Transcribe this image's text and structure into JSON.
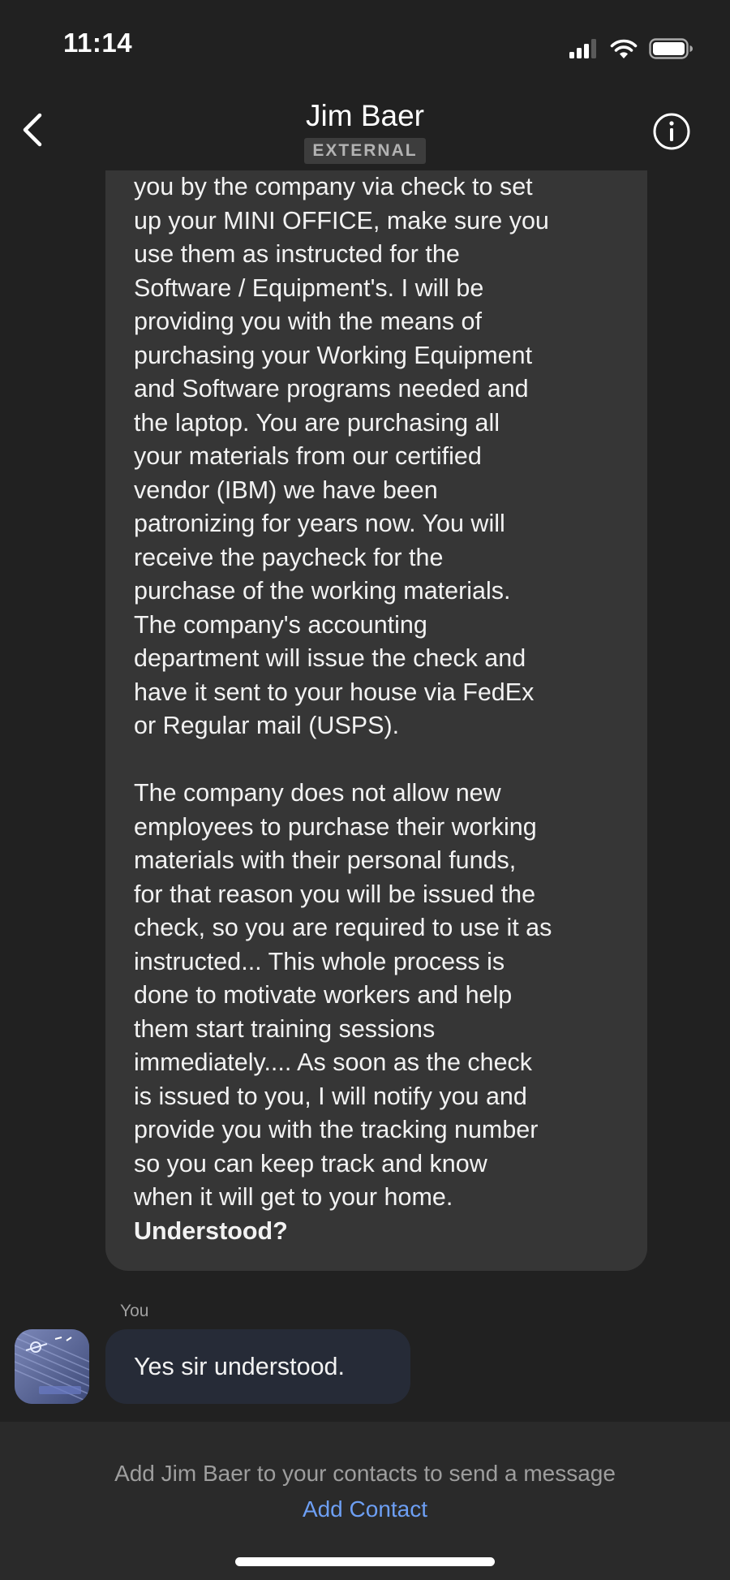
{
  "status_bar": {
    "time": "11:14",
    "signal_icon": "cellular-signal-icon",
    "wifi_icon": "wifi-icon",
    "battery_icon": "battery-icon"
  },
  "header": {
    "back_icon": "chevron-left-icon",
    "title": "Jim Baer",
    "badge": "EXTERNAL",
    "info_icon": "info-circle-icon"
  },
  "messages": {
    "incoming_para1": [
      "you by the company via check to set",
      "up your MINI OFFICE, make sure you",
      "use them as instructed for the",
      "Software / Equipment's. I will be",
      "providing you with the means of",
      "purchasing your Working Equipment",
      "and  Software programs needed and",
      "the laptop. You are purchasing all",
      "your materials from our certified",
      "vendor (IBM) we have been",
      "patronizing for years now. You will",
      "receive the paycheck for the",
      "purchase of the working materials.",
      "The company's accounting",
      "department will issue the check and",
      "have it sent to your house via FedEx",
      "or Regular mail (USPS)."
    ],
    "incoming_para2": [
      "The company does not allow new",
      "employees to purchase their working",
      "materials with their personal funds,",
      "for that reason you will be issued the",
      "check, so you are required to use it as",
      "instructed...  This whole process is",
      "done to motivate workers and help",
      "them start training sessions",
      "immediately.... As soon as the check",
      "is issued to you, I will notify you and",
      "provide you with the tracking number",
      "so you can keep track and know",
      "when it will get to your home."
    ],
    "incoming_bold": "Understood?",
    "you_label": "You",
    "outgoing_text": "Yes sir understood."
  },
  "footer": {
    "prompt": "Add Jim Baer to your contacts to send a message",
    "link": "Add Contact"
  },
  "colors": {
    "background": "#212121",
    "incoming_bubble": "#363636",
    "outgoing_bubble": "#262b37",
    "link": "#6d9ff4",
    "badge_bg": "#3d3d3d"
  }
}
